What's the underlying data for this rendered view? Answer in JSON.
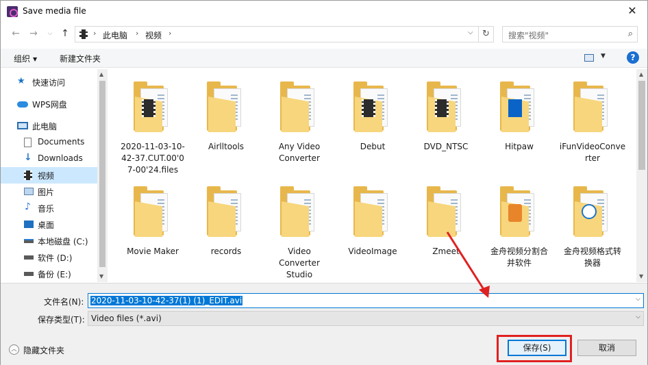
{
  "window": {
    "title": "Save media file",
    "close": "✕"
  },
  "nav": {
    "crumbs": [
      "此电脑",
      "视频"
    ],
    "search_placeholder": "搜索\"视频\""
  },
  "toolbar": {
    "organize": "组织",
    "new_folder": "新建文件夹",
    "help": "?"
  },
  "sidebar": {
    "items": [
      {
        "label": "快速访问",
        "icon": "star-icon"
      },
      {
        "label": "WPS网盘",
        "icon": "cloud-icon"
      },
      {
        "label": "此电脑",
        "icon": "computer-icon"
      },
      {
        "label": "Documents",
        "icon": "document-icon"
      },
      {
        "label": "Downloads",
        "icon": "download-icon"
      },
      {
        "label": "视频",
        "icon": "video-icon",
        "selected": true
      },
      {
        "label": "图片",
        "icon": "picture-icon"
      },
      {
        "label": "音乐",
        "icon": "music-icon"
      },
      {
        "label": "桌面",
        "icon": "desktop-icon"
      },
      {
        "label": "本地磁盘 (C:)",
        "icon": "drive-c-icon"
      },
      {
        "label": "软件 (D:)",
        "icon": "drive-icon"
      },
      {
        "label": "备份 (E:)",
        "icon": "drive-icon"
      }
    ]
  },
  "folders": [
    {
      "name": "2020-11-03-10-42-37.CUT.00'07-00'24.files",
      "line1": "2020-11-03-10-",
      "line2": "42-37.CUT.00'0",
      "line3": "7-00'24.files",
      "badge": "film"
    },
    {
      "name": "Airlltools",
      "line1": "Airlltools",
      "badge": "none"
    },
    {
      "name": "Any Video Converter",
      "line1": "Any Video",
      "line2": "Converter",
      "badge": "none"
    },
    {
      "name": "Debut",
      "line1": "Debut",
      "badge": "film"
    },
    {
      "name": "DVD_NTSC",
      "line1": "DVD_NTSC",
      "badge": "film"
    },
    {
      "name": "Hitpaw",
      "line1": "Hitpaw",
      "badge": "blue"
    },
    {
      "name": "iFunVideoConverter",
      "line1": "iFunVideoConve",
      "line2": "rter",
      "badge": "none"
    },
    {
      "name": "Movie Maker",
      "line1": "Movie Maker",
      "badge": "none"
    },
    {
      "name": "records",
      "line1": "records",
      "badge": "none"
    },
    {
      "name": "Video Converter Studio",
      "line1": "Video",
      "line2": "Converter",
      "line3": "Studio",
      "badge": "none"
    },
    {
      "name": "VideoImage",
      "line1": "VideoImage",
      "badge": "none"
    },
    {
      "name": "Zmeet",
      "line1": "Zmeet",
      "badge": "none"
    },
    {
      "name": "金舟视频分割合并软件",
      "line1": "金舟视频分割合",
      "line2": "并软件",
      "badge": "orange"
    },
    {
      "name": "金舟视频格式转换器",
      "line1": "金舟视频格式转",
      "line2": "换器",
      "badge": "circle"
    }
  ],
  "form": {
    "filename_label": "文件名(N):",
    "filename_value": "2020-11-03-10-42-37(1) (1)_EDIT.avi",
    "filetype_label": "保存类型(T):",
    "filetype_value": "Video files (*.avi)",
    "hide_folders": "隐藏文件夹",
    "save": "保存(S)",
    "cancel": "取消"
  },
  "annotation_color": "#e02020"
}
